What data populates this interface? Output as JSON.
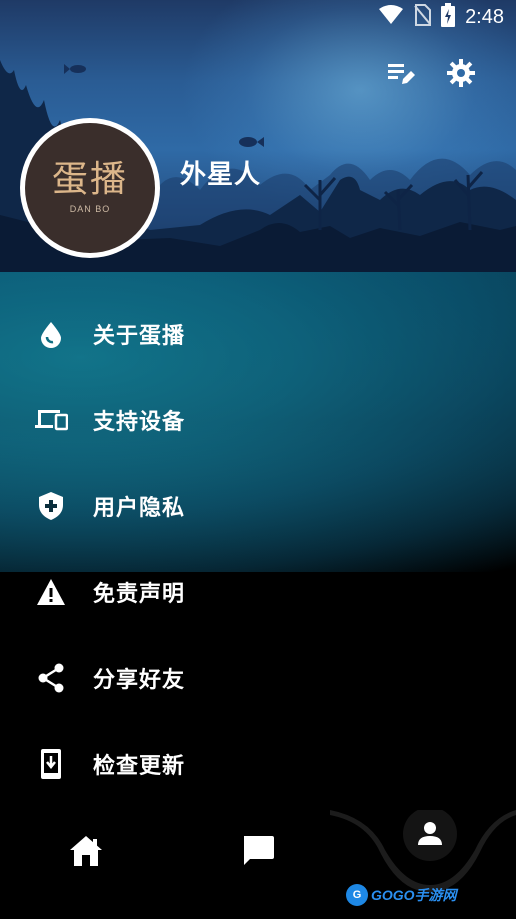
{
  "status_bar": {
    "time": "2:48"
  },
  "profile": {
    "avatar_logo": "蛋播",
    "avatar_sub": "DAN BO",
    "username": "外星人"
  },
  "top_actions": [
    {
      "icon": "edit-list-icon"
    },
    {
      "icon": "settings-gear-icon"
    }
  ],
  "menu": {
    "items": [
      {
        "icon": "drop-icon",
        "label": "关于蛋播"
      },
      {
        "icon": "devices-icon",
        "label": "支持设备"
      },
      {
        "icon": "shield-icon",
        "label": "用户隐私"
      },
      {
        "icon": "warning-icon",
        "label": "免责声明"
      },
      {
        "icon": "share-icon",
        "label": "分享好友"
      },
      {
        "icon": "update-icon",
        "label": "检查更新"
      }
    ]
  },
  "bottom_nav": [
    {
      "icon": "home-icon"
    },
    {
      "icon": "chat-icon"
    },
    {
      "icon": "person-icon",
      "active": true
    }
  ],
  "watermark": {
    "logo": "G",
    "text": "GOGO手游网"
  },
  "colors": {
    "header": "#2f6aa6",
    "menu_glow": "#1aa4b4",
    "text": "#ffffff"
  }
}
